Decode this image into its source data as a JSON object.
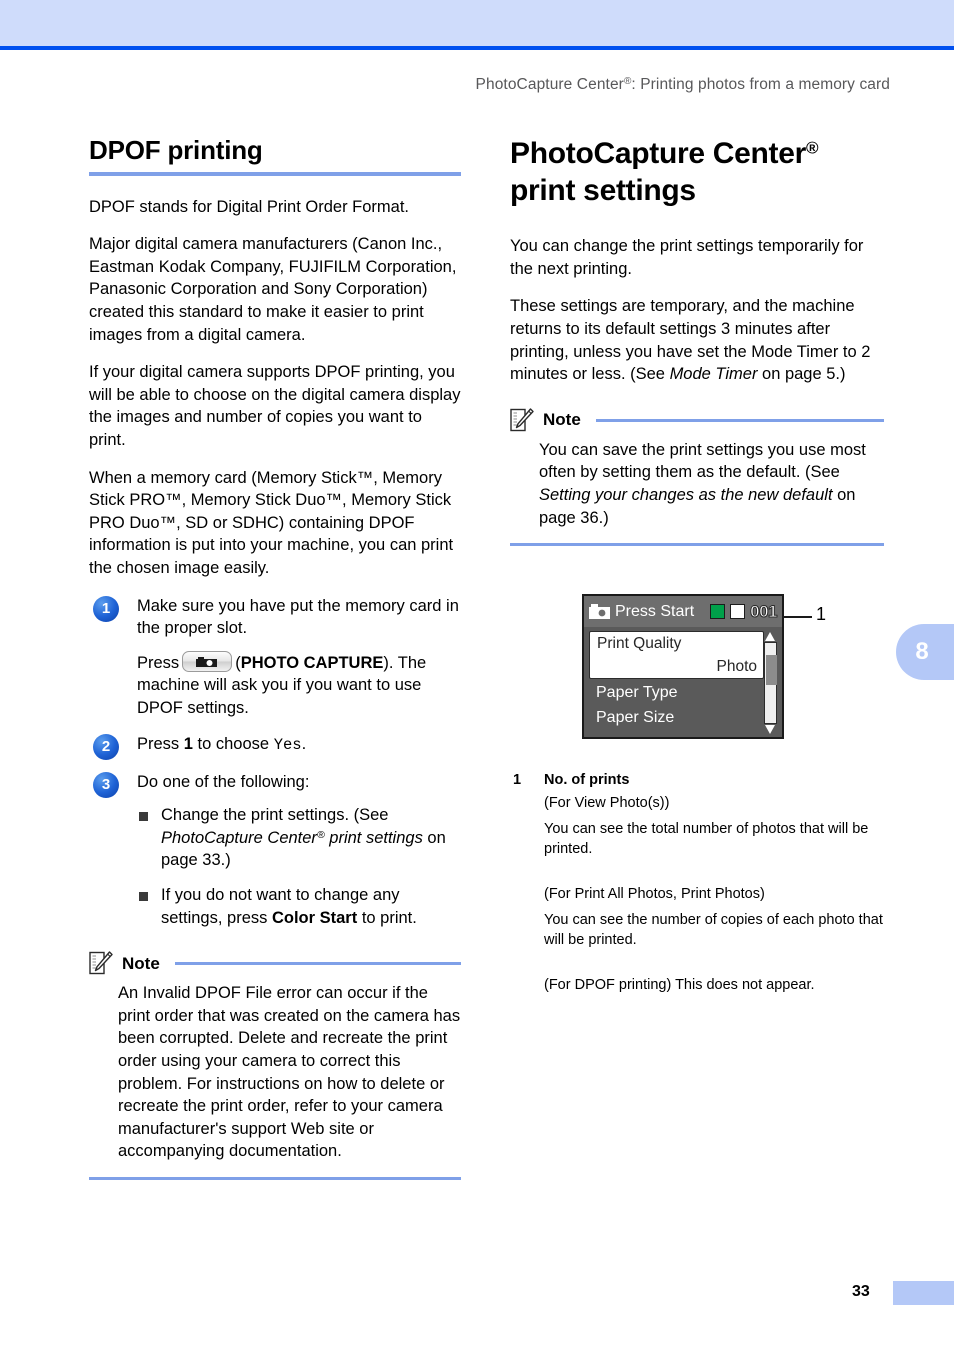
{
  "page": {
    "running_header": "PhotoCapture Center",
    "running_header_sup": "®",
    "running_header_tail": ": Printing photos from a memory card",
    "page_number": "33",
    "chapter_tab": "8",
    "accent_blue": "#0050f0",
    "band_blue": "#cfdcfb",
    "rule_blue": "#7fa0e8",
    "tab_blue": "#b4c8f7"
  },
  "left": {
    "heading": "DPOF printing",
    "p1": "DPOF stands for Digital Print Order Format.",
    "p2": "Major digital camera manufacturers (Canon Inc., Eastman Kodak Company, FUJIFILM Corporation, Panasonic Corporation and Sony Corporation) created this standard to make it easier to print images from a digital camera.",
    "p3": "If your digital camera supports DPOF printing, you will be able to choose on the digital camera display the images and number of copies you want to print.",
    "p4": "When a memory card (Memory Stick™, Memory Stick PRO™, Memory Stick Duo™, Memory Stick PRO Duo™, SD or SDHC) containing DPOF information is put into your machine, you can print the chosen image easily.",
    "steps": [
      {
        "num": "1",
        "line1": "Make sure you have put the memory card in the proper slot.",
        "line2_pre": "Press",
        "line2_mid": "(",
        "line2_bold": "PHOTO CAPTURE",
        "line2_post": "). The machine will ask you if you want to use DPOF settings.",
        "key_icon": "photo-capture-camera-icon"
      },
      {
        "num": "2",
        "pre": "Press ",
        "bold": "1",
        "mid": " to choose ",
        "mono": "Yes",
        "post": "."
      },
      {
        "num": "3",
        "line1": "Do one of the following:"
      }
    ],
    "bullets": [
      {
        "pre": "Change the print settings. (See ",
        "italic": "PhotoCapture Center",
        "italic_sup": "®",
        "italic2": " print settings",
        "post": " on page 33.)"
      },
      {
        "pre": "If you do not want to change any settings, press ",
        "bold": "Color Start",
        "post": " to print."
      }
    ],
    "note": {
      "icon": "note-pencil-paper-icon",
      "title": "Note",
      "body": "An Invalid DPOF File error can occur if the print order that was created on the camera has been corrupted. Delete and recreate the print order using your camera to correct this problem. For instructions on how to delete or recreate the print order, refer to your camera manufacturer's support Web site or accompanying documentation."
    }
  },
  "right": {
    "heading_line1": "PhotoCapture Center",
    "heading_sup": "®",
    "heading_line2": "print settings",
    "p1": "You can change the print settings temporarily for the next printing.",
    "p2_pre": "These settings are temporary, and the machine returns to its default settings 3 minutes after printing, unless you have set the Mode Timer to 2 minutes or less. (See ",
    "p2_italic": "Mode Timer",
    "p2_post": " on page 5.)",
    "note": {
      "icon": "note-pencil-paper-icon",
      "title": "Note",
      "body_pre": "You can save the print settings you use most often by setting them as the default. (See ",
      "body_italic": "Setting your changes as the new default",
      "body_post": " on page 36.)"
    },
    "lcd": {
      "camera_icon": "lcd-camera-icon",
      "press_start": "Press Start",
      "indicator_green": "#00a04a",
      "indicator_white": "#ffffff",
      "count": "001",
      "selected_label": "Print Quality",
      "selected_value": "Photo",
      "row1": "Paper Type",
      "row2": "Paper Size",
      "callout": "1"
    },
    "legend": {
      "key": "1",
      "title": "No. of prints",
      "sub1": "(For View Photo(s))",
      "text1": "You can see the total number of photos that will be printed.",
      "sub2": "(For Print All Photos, Print Photos)",
      "text2": "You can see the number of copies of each photo that will be printed.",
      "text3": "(For DPOF printing) This does not appear."
    }
  }
}
